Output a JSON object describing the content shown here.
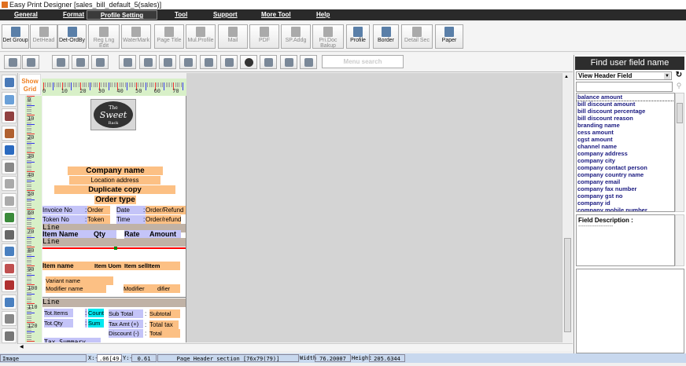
{
  "window": {
    "title": "Easy Print Designer [sales_bill_default_5(sales)]"
  },
  "menu": [
    "General",
    "Format",
    "Profile Setting",
    "Tool",
    "Support",
    "More Tool",
    "Help"
  ],
  "menu_selected": "Profile Setting",
  "toolbar": [
    {
      "label": "Det Group",
      "enabled": true
    },
    {
      "label": "DetHead",
      "enabled": false
    },
    {
      "label": "Det-OrdBy",
      "enabled": true
    },
    {
      "label": "Reg Lng Edit",
      "enabled": false
    },
    {
      "label": "WaterMark",
      "enabled": false
    },
    {
      "label": "Page Title",
      "enabled": false
    },
    {
      "label": "Mul.Profile",
      "enabled": false
    },
    {
      "label": "Mail",
      "enabled": false
    },
    {
      "label": "PDF",
      "enabled": false
    },
    {
      "label": "SP.Addg",
      "enabled": false
    },
    {
      "label": "Pri.Doc Bakup",
      "enabled": false
    },
    {
      "label": "Profile",
      "enabled": true
    },
    {
      "label": "Border",
      "enabled": true
    },
    {
      "label": "Detail Sec",
      "enabled": false
    },
    {
      "label": "Paper",
      "enabled": true
    }
  ],
  "toolbar2": {
    "icons": [
      "preview-icon",
      "print-icon",
      "edit-icon",
      "delete-icon",
      "settings-icon",
      "timer-icon",
      "insert-icon",
      "cloud-upload-icon",
      "cloud-download-icon",
      "receipt-printer-icon",
      "camera-icon",
      "globe-icon",
      "scanner-icon",
      "printer-gear-icon",
      "print-list-icon"
    ],
    "menu_search_placeholder": "Menu search"
  },
  "designer": {
    "show_grid": "Show Grid",
    "hruler_labels": [
      "0",
      "10",
      "20",
      "30",
      "40",
      "50",
      "60",
      "70"
    ],
    "vruler_labels": [
      "0",
      "10",
      "20",
      "30",
      "40",
      "50",
      "60",
      "70",
      "80",
      "90",
      "100",
      "110",
      "120"
    ],
    "logo_text": "The Sweet Rack",
    "fields": {
      "company_name": "Company name",
      "location_address": "Location address",
      "duplicate_copy": "Duplicate copy",
      "order_type": "Order type",
      "invoice_no": "Invoice No",
      "colon": ":",
      "order": "Order",
      "date": "Date",
      "order_refund": "Order/Refund",
      "token_no": "Token No",
      "token": "Token",
      "time": "Time",
      "order_refund2": "Order/refund",
      "line": "Line",
      "item_name_h": "Item Name",
      "qty_h": "Qty",
      "rate_h": "Rate",
      "amount_h": "Amount",
      "item_name": "Item name",
      "item_uom": "Item Uom",
      "item_sell": "Item sellItem",
      "variant_name": "Variant name",
      "modifier_name": "Modifier name",
      "modifier": "Modifier",
      "modifier2": "difier",
      "tot_items": "Tot.Items",
      "count": "Count",
      "sub_total": "Sub Total",
      "subtotal": "Subtotal",
      "tot_qty": "Tot.Qty",
      "sum": "Sum",
      "tax_amt": "Tax Amt  (+)",
      "total_tax": "Total tax",
      "discount": "Discount  (-)",
      "total": "Total",
      "tax_summary": "Tax  Summary"
    }
  },
  "right_panel": {
    "header": "Find user field name",
    "view_select": "View Header Field",
    "search_value": "",
    "fields": [
      "balance amount",
      "bill discount amount",
      "bill discount percentage",
      "bill discount reason",
      "branding name",
      "cess amount",
      "cgst amount",
      "channel name",
      "company address",
      "company city",
      "company contact person",
      "company country name",
      "company email",
      "company fax number",
      "company gst no",
      "company id",
      "company mobile number"
    ],
    "selected": "balance amount",
    "description_label": "Field Description :",
    "description_value": "-------------------"
  },
  "status": {
    "mode": "Image",
    "x_label": "X:-",
    "x_value": ".06[49.1]",
    "y_label": "Y:-",
    "y_value": "0.61",
    "section": "Page Header section [76x79(79)]",
    "width_label": "Width",
    "width_value": "76.20007",
    "height_label": "Height",
    "height_value": "205.6344"
  },
  "colors": {
    "menubar": "#2a2a2a",
    "field_orange": "#fcc084",
    "field_blue": "#c4c4f8",
    "field_cyan": "#00e8f0",
    "line_band": "#c0b2a6",
    "ruler": "#d8f0c8"
  }
}
